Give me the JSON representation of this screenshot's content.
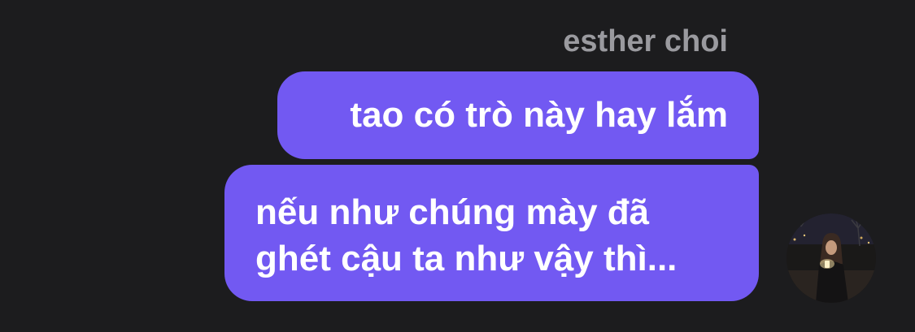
{
  "conversation": {
    "sender_name": "esther choi",
    "messages": [
      {
        "lines": [
          "tao có trò này hay lắm"
        ]
      },
      {
        "lines": [
          "nếu như chúng mày đã",
          "ghét cậu ta như vậy thì..."
        ]
      }
    ]
  },
  "colors": {
    "background": "#1c1c1e",
    "bubble": "#7259f2",
    "sender_name": "#9a9a9f",
    "message_text": "#ffffff"
  },
  "avatar": {
    "icon": "profile-photo"
  }
}
